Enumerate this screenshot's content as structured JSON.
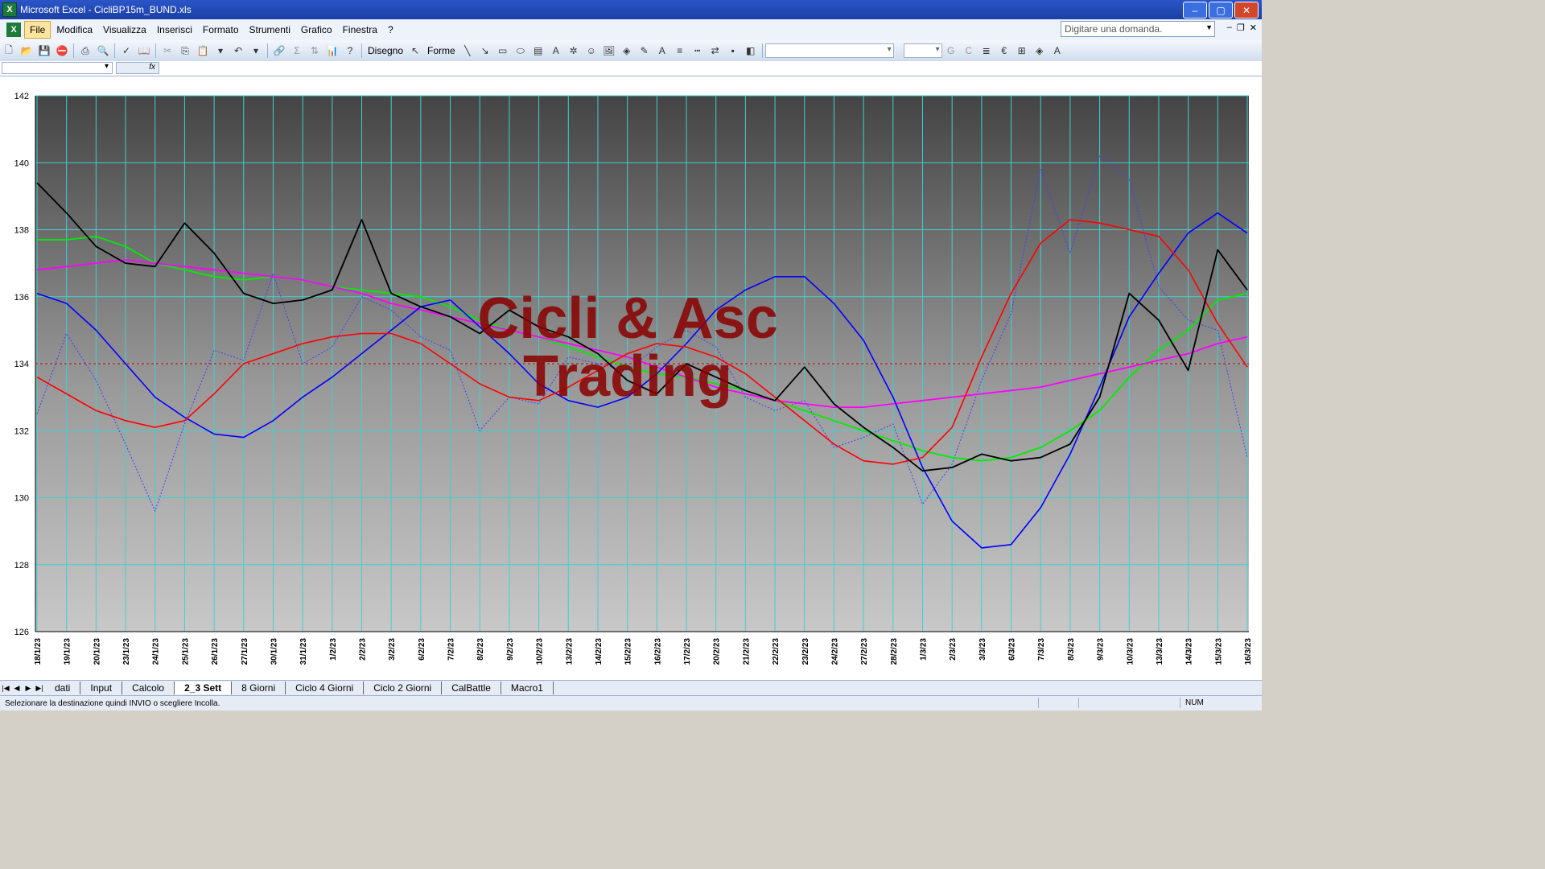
{
  "window": {
    "title": "Microsoft Excel - CicliBP15m_BUND.xls"
  },
  "menu": {
    "items": [
      "File",
      "Modifica",
      "Visualizza",
      "Inserisci",
      "Formato",
      "Strumenti",
      "Grafico",
      "Finestra",
      "?"
    ]
  },
  "help": {
    "placeholder": "Digitare una domanda."
  },
  "toolbar": {
    "draw_label": "Disegno",
    "shapes_label": "Forme",
    "fx": "fx"
  },
  "chart_data": {
    "type": "line",
    "ylim": [
      126,
      142
    ],
    "yticks": [
      126,
      128,
      130,
      132,
      134,
      136,
      138,
      140,
      142
    ],
    "x_labels": [
      "18/1/23",
      "19/1/23",
      "20/1/23",
      "23/1/23",
      "24/1/23",
      "25/1/23",
      "26/1/23",
      "27/1/23",
      "30/1/23",
      "31/1/23",
      "1/2/23",
      "2/2/23",
      "3/2/23",
      "6/2/23",
      "7/2/23",
      "8/2/23",
      "9/2/23",
      "10/2/23",
      "13/2/23",
      "14/2/23",
      "15/2/23",
      "16/2/23",
      "17/2/23",
      "20/2/23",
      "21/2/23",
      "22/2/23",
      "23/2/23",
      "24/2/23",
      "27/2/23",
      "28/2/23",
      "1/3/23",
      "2/3/23",
      "3/3/23",
      "6/3/23",
      "7/3/23",
      "8/3/23",
      "9/3/23",
      "10/3/23",
      "13/3/23",
      "14/3/23",
      "15/3/23",
      "16/3/23"
    ],
    "reference_line": 134,
    "colors": {
      "price": "#000000",
      "green": "#00ee00",
      "magenta": "#ff00ff",
      "blue": "#0000ff",
      "red": "#ff0000",
      "dotted": "#4040ff",
      "reference": "#ff0000"
    },
    "series": [
      {
        "values": [
          139.4,
          138.5,
          137.5,
          137.0,
          136.9,
          138.2,
          137.3,
          136.1,
          135.8,
          135.9,
          136.2,
          138.3,
          136.1,
          135.7,
          135.4,
          134.9,
          135.6,
          135.1,
          134.8,
          134.3,
          133.5,
          133.1,
          134.0,
          133.6,
          133.2,
          132.9,
          133.9,
          132.8,
          132.1,
          131.5,
          130.8,
          130.9,
          131.3,
          131.1,
          131.2,
          131.6,
          133.0,
          136.1,
          135.3,
          133.8,
          137.4,
          136.2
        ]
      },
      {
        "values": [
          137.7,
          137.7,
          137.8,
          137.5,
          137.0,
          136.8,
          136.6,
          136.5,
          136.6,
          136.5,
          136.3,
          136.2,
          136.1,
          136.0,
          135.7,
          135.3,
          135.0,
          134.8,
          134.5,
          134.2,
          133.9,
          133.7,
          133.6,
          133.4,
          133.2,
          132.9,
          132.6,
          132.3,
          132.0,
          131.7,
          131.4,
          131.2,
          131.1,
          131.2,
          131.5,
          132.0,
          132.6,
          133.6,
          134.4,
          135.0,
          135.9,
          136.1
        ]
      },
      {
        "values": [
          136.8,
          136.9,
          137.0,
          137.1,
          137.0,
          136.9,
          136.8,
          136.7,
          136.6,
          136.5,
          136.3,
          136.1,
          135.8,
          135.6,
          135.4,
          135.2,
          135.0,
          134.8,
          134.6,
          134.4,
          134.2,
          133.9,
          133.6,
          133.3,
          133.1,
          132.9,
          132.8,
          132.7,
          132.7,
          132.8,
          132.9,
          133.0,
          133.1,
          133.2,
          133.3,
          133.5,
          133.7,
          133.9,
          134.1,
          134.3,
          134.6,
          134.8
        ]
      },
      {
        "values": [
          136.1,
          135.8,
          135.0,
          134.0,
          133.0,
          132.4,
          131.9,
          131.8,
          132.3,
          133.0,
          133.6,
          134.3,
          135.0,
          135.7,
          135.9,
          135.1,
          134.3,
          133.4,
          132.9,
          132.7,
          133.0,
          133.7,
          134.6,
          135.6,
          136.2,
          136.6,
          136.6,
          135.8,
          134.7,
          133.0,
          130.9,
          129.3,
          128.5,
          128.6,
          129.7,
          131.3,
          133.3,
          135.4,
          136.7,
          137.9,
          138.5,
          137.9
        ]
      },
      {
        "values": [
          133.6,
          133.1,
          132.6,
          132.3,
          132.1,
          132.3,
          133.1,
          134.0,
          134.3,
          134.6,
          134.8,
          134.9,
          134.9,
          134.6,
          134.0,
          133.4,
          133.0,
          132.9,
          133.3,
          133.8,
          134.3,
          134.6,
          134.5,
          134.2,
          133.7,
          133.0,
          132.3,
          131.6,
          131.1,
          131.0,
          131.2,
          132.1,
          134.2,
          136.1,
          137.6,
          138.3,
          138.2,
          138.0,
          137.8,
          136.8,
          135.2,
          133.9
        ]
      },
      {
        "values": [
          132.5,
          134.9,
          133.5,
          131.6,
          129.6,
          132.2,
          134.4,
          134.1,
          136.7,
          134.0,
          134.5,
          136.0,
          135.6,
          134.8,
          134.4,
          132.0,
          133.0,
          132.8,
          134.2,
          134.0,
          133.8,
          134.5,
          135.0,
          134.5,
          133.0,
          132.6,
          132.9,
          131.5,
          131.8,
          132.2,
          129.8,
          131.0,
          133.5,
          135.5,
          139.8,
          137.3,
          140.2,
          139.5,
          136.3,
          135.3,
          135.0,
          131.2
        ]
      }
    ]
  },
  "watermark": {
    "line1": "Cicli & Asc",
    "line2": "Trading"
  },
  "sheets": {
    "tabs": [
      "dati",
      "Input",
      "Calcolo",
      "2_3 Sett",
      "8 Giorni",
      "Ciclo 4 Giorni",
      "Ciclo 2 Giorni",
      "CalBattle",
      "Macro1"
    ],
    "active": 3
  },
  "status": {
    "message": "Selezionare la destinazione quindi INVIO o scegliere Incolla.",
    "num": "NUM"
  }
}
